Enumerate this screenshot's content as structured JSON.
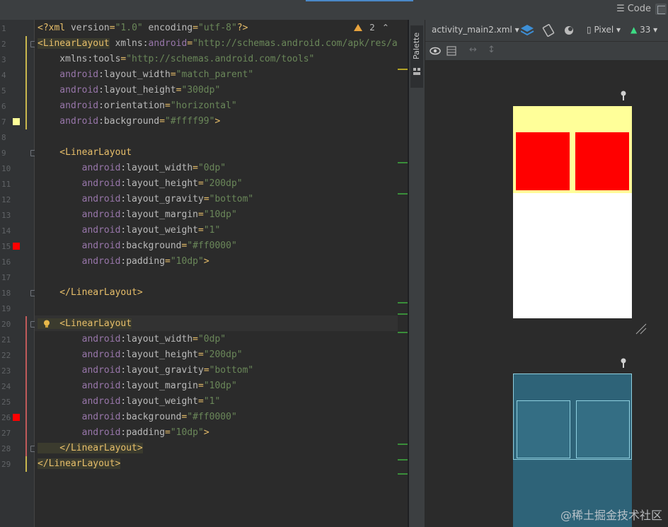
{
  "topbar": {
    "code_label": "Code"
  },
  "editor": {
    "warnings_count": "2",
    "lines": [
      {
        "no": "1",
        "parts": [
          [
            "pi",
            "<?xml "
          ],
          [
            "attr",
            "version"
          ],
          [
            "punc",
            "="
          ],
          [
            "str",
            "\"1.0\""
          ],
          [
            "attr",
            " encoding"
          ],
          [
            "punc",
            "="
          ],
          [
            "str",
            "\"utf-8\""
          ],
          [
            "pi",
            "?>"
          ]
        ]
      },
      {
        "no": "2",
        "parts": [
          [
            "tagbg",
            "<LinearLayout"
          ],
          [
            "attr",
            " xmlns:"
          ],
          [
            "ns",
            "android"
          ],
          [
            "punc",
            "="
          ],
          [
            "str",
            "\"http://schemas.android.com/apk/res/an"
          ]
        ]
      },
      {
        "no": "3",
        "parts": [
          [
            "attr",
            "    xmlns:tools"
          ],
          [
            "punc",
            "="
          ],
          [
            "str",
            "\"http://schemas.android.com/tools\""
          ]
        ]
      },
      {
        "no": "4",
        "parts": [
          [
            "ns",
            "    android"
          ],
          [
            "attr",
            ":layout_width"
          ],
          [
            "punc",
            "="
          ],
          [
            "str",
            "\"match_parent\""
          ]
        ]
      },
      {
        "no": "5",
        "parts": [
          [
            "ns",
            "    android"
          ],
          [
            "attr",
            ":layout_height"
          ],
          [
            "punc",
            "="
          ],
          [
            "str",
            "\"300dp\""
          ]
        ]
      },
      {
        "no": "6",
        "parts": [
          [
            "ns",
            "    android"
          ],
          [
            "attr",
            ":orientation"
          ],
          [
            "punc",
            "="
          ],
          [
            "str",
            "\"horizontal\""
          ]
        ]
      },
      {
        "no": "7",
        "parts": [
          [
            "ns",
            "    android"
          ],
          [
            "attr",
            ":background"
          ],
          [
            "punc",
            "="
          ],
          [
            "str",
            "\"#ffff99\""
          ],
          [
            "punc",
            ">"
          ]
        ]
      },
      {
        "no": "8",
        "parts": []
      },
      {
        "no": "9",
        "parts": [
          [
            "tag",
            "    <LinearLayout"
          ]
        ]
      },
      {
        "no": "10",
        "parts": [
          [
            "ns",
            "        android"
          ],
          [
            "attr",
            ":layout_width"
          ],
          [
            "punc",
            "="
          ],
          [
            "str",
            "\"0dp\""
          ]
        ]
      },
      {
        "no": "11",
        "parts": [
          [
            "ns",
            "        android"
          ],
          [
            "attr",
            ":layout_height"
          ],
          [
            "punc",
            "="
          ],
          [
            "str",
            "\"200dp\""
          ]
        ]
      },
      {
        "no": "12",
        "parts": [
          [
            "ns",
            "        android"
          ],
          [
            "attr",
            ":layout_gravity"
          ],
          [
            "punc",
            "="
          ],
          [
            "str",
            "\"bottom\""
          ]
        ]
      },
      {
        "no": "13",
        "parts": [
          [
            "ns",
            "        android"
          ],
          [
            "attr",
            ":layout_margin"
          ],
          [
            "punc",
            "="
          ],
          [
            "str",
            "\"10dp\""
          ]
        ]
      },
      {
        "no": "14",
        "parts": [
          [
            "ns",
            "        android"
          ],
          [
            "attr",
            ":layout_weight"
          ],
          [
            "punc",
            "="
          ],
          [
            "str",
            "\"1\""
          ]
        ]
      },
      {
        "no": "15",
        "parts": [
          [
            "ns",
            "        android"
          ],
          [
            "attr",
            ":background"
          ],
          [
            "punc",
            "="
          ],
          [
            "str",
            "\"#ff0000\""
          ]
        ]
      },
      {
        "no": "16",
        "parts": [
          [
            "ns",
            "        android"
          ],
          [
            "attr",
            ":padding"
          ],
          [
            "punc",
            "="
          ],
          [
            "str",
            "\"10dp\""
          ],
          [
            "punc",
            ">"
          ]
        ]
      },
      {
        "no": "17",
        "parts": []
      },
      {
        "no": "18",
        "parts": [
          [
            "tag",
            "    </LinearLayout>"
          ]
        ]
      },
      {
        "no": "19",
        "parts": []
      },
      {
        "no": "20",
        "parts": [
          [
            "tagbg",
            "    <LinearLayout"
          ]
        ]
      },
      {
        "no": "21",
        "parts": [
          [
            "ns",
            "        android"
          ],
          [
            "attr",
            ":layout_width"
          ],
          [
            "punc",
            "="
          ],
          [
            "str",
            "\"0dp\""
          ]
        ]
      },
      {
        "no": "22",
        "parts": [
          [
            "ns",
            "        android"
          ],
          [
            "attr",
            ":layout_height"
          ],
          [
            "punc",
            "="
          ],
          [
            "str",
            "\"200dp\""
          ]
        ]
      },
      {
        "no": "23",
        "parts": [
          [
            "ns",
            "        android"
          ],
          [
            "attr",
            ":layout_gravity"
          ],
          [
            "punc",
            "="
          ],
          [
            "str",
            "\"bottom\""
          ]
        ]
      },
      {
        "no": "24",
        "parts": [
          [
            "ns",
            "        android"
          ],
          [
            "attr",
            ":layout_margin"
          ],
          [
            "punc",
            "="
          ],
          [
            "str",
            "\"10dp\""
          ]
        ]
      },
      {
        "no": "25",
        "parts": [
          [
            "ns",
            "        android"
          ],
          [
            "attr",
            ":layout_weight"
          ],
          [
            "punc",
            "="
          ],
          [
            "str",
            "\"1\""
          ]
        ]
      },
      {
        "no": "26",
        "parts": [
          [
            "ns",
            "        android"
          ],
          [
            "attr",
            ":background"
          ],
          [
            "punc",
            "="
          ],
          [
            "str",
            "\"#ff0000\""
          ]
        ]
      },
      {
        "no": "27",
        "parts": [
          [
            "ns",
            "        android"
          ],
          [
            "attr",
            ":padding"
          ],
          [
            "punc",
            "="
          ],
          [
            "str",
            "\"10dp\""
          ],
          [
            "punc",
            ">"
          ]
        ]
      },
      {
        "no": "28",
        "parts": [
          [
            "tagbg",
            "    </LinearLayout>"
          ]
        ]
      },
      {
        "no": "29",
        "parts": [
          [
            "tagbg",
            "</LinearLayout>"
          ]
        ]
      }
    ]
  },
  "palette": {
    "label": "Palette"
  },
  "design": {
    "file_label": "activity_main2.xml",
    "device_label": "Pixel",
    "api_label": "33",
    "colors": {
      "outer_bg": "#ffff99",
      "inner_bg": "#ff0000"
    }
  },
  "watermark": "@稀土掘金技术社区"
}
